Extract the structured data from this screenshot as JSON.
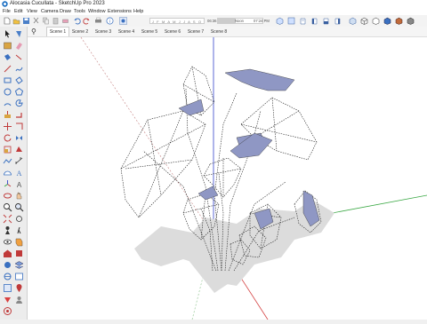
{
  "window": {
    "title": "Alocasia Cucullata - SketchUp Pro 2023"
  },
  "menu": [
    "File",
    "Edit",
    "View",
    "Camera",
    "Draw",
    "Tools",
    "Window",
    "Extensions",
    "Help"
  ],
  "shadow_settings": {
    "months": "J F M A M J J A S O N D",
    "selected_month": "O",
    "start_time": "06:36 AM",
    "noon_label": "Noon",
    "end_time": "07:24 PM",
    "time_position": 0.4
  },
  "scenes": [
    "Scene 1",
    "Scene 2",
    "Scene 3",
    "Scene 4",
    "Scene 5",
    "Scene 6",
    "Scene 7",
    "Scene 8"
  ],
  "active_scene": "Scene 1",
  "toolbar_icons": [
    "new-file-icon",
    "open-icon",
    "save-icon",
    "cut-icon",
    "copy-icon",
    "paste-icon",
    "erase-icon",
    "undo-icon",
    "redo-icon",
    "print-icon",
    "model-info-icon",
    "shadows-icon",
    "iso-view-icon",
    "top-view-icon",
    "front-view-icon",
    "right-view-icon",
    "back-view-icon",
    "left-view-icon",
    "xray-icon",
    "wireframe-icon",
    "hidden-line-icon",
    "shaded-icon",
    "textured-icon",
    "monochrome-icon"
  ],
  "colors": {
    "leaf_fill": "#8f97c4",
    "axis_red": "#d44040",
    "axis_green": "#3aa844",
    "axis_blue": "#3344cc",
    "shadow": "#dcdcdc"
  }
}
